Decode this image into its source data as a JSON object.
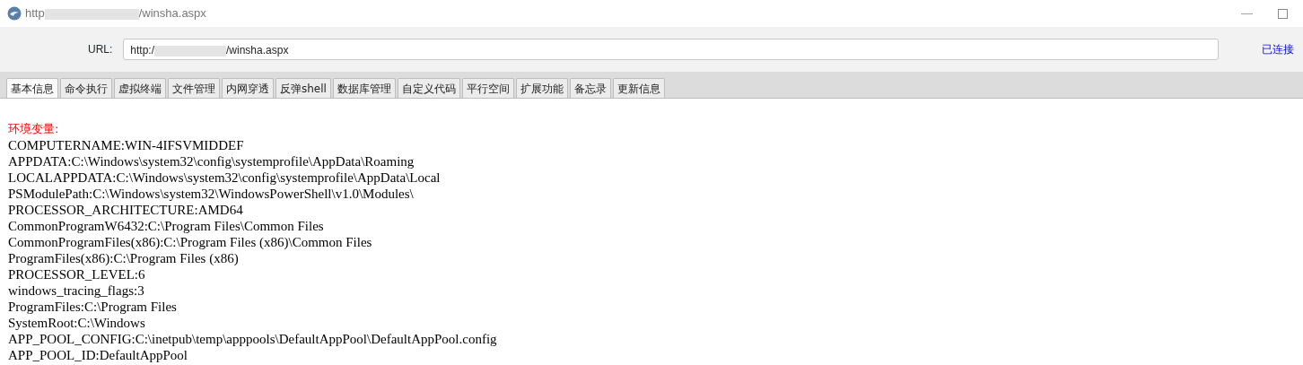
{
  "window": {
    "title_start": "http",
    "title_end": "/winsha.aspx",
    "minimize": "—"
  },
  "url_bar": {
    "label": "URL:",
    "value_start": "http:/",
    "value_end": "/winsha.aspx",
    "status": "已连接"
  },
  "tabs": [
    {
      "label": "基本信息",
      "selected": true
    },
    {
      "label": "命令执行",
      "selected": false
    },
    {
      "label": "虚拟终端",
      "selected": false
    },
    {
      "label": "文件管理",
      "selected": false
    },
    {
      "label": "内网穿透",
      "selected": false
    },
    {
      "label": "反弹shell",
      "selected": false
    },
    {
      "label": "数据库管理",
      "selected": false
    },
    {
      "label": "自定义代码",
      "selected": false
    },
    {
      "label": "平行空间",
      "selected": false
    },
    {
      "label": "扩展功能",
      "selected": false
    },
    {
      "label": "备忘录",
      "selected": false
    },
    {
      "label": "更新信息",
      "selected": false
    }
  ],
  "content": {
    "heading": "环境变量:",
    "lines": [
      "COMPUTERNAME:WIN-4IFSVMIDDEF",
      "APPDATA:C:\\Windows\\system32\\config\\systemprofile\\AppData\\Roaming",
      "LOCALAPPDATA:C:\\Windows\\system32\\config\\systemprofile\\AppData\\Local",
      "PSModulePath:C:\\Windows\\system32\\WindowsPowerShell\\v1.0\\Modules\\",
      "PROCESSOR_ARCHITECTURE:AMD64",
      "CommonProgramW6432:C:\\Program Files\\Common Files",
      "CommonProgramFiles(x86):C:\\Program Files (x86)\\Common Files",
      "ProgramFiles(x86):C:\\Program Files (x86)",
      "PROCESSOR_LEVEL:6",
      "windows_tracing_flags:3",
      "ProgramFiles:C:\\Program Files",
      "SystemRoot:C:\\Windows",
      "APP_POOL_CONFIG:C:\\inetpub\\temp\\apppools\\DefaultAppPool\\DefaultAppPool.config",
      "APP_POOL_ID:DefaultAppPool"
    ]
  }
}
